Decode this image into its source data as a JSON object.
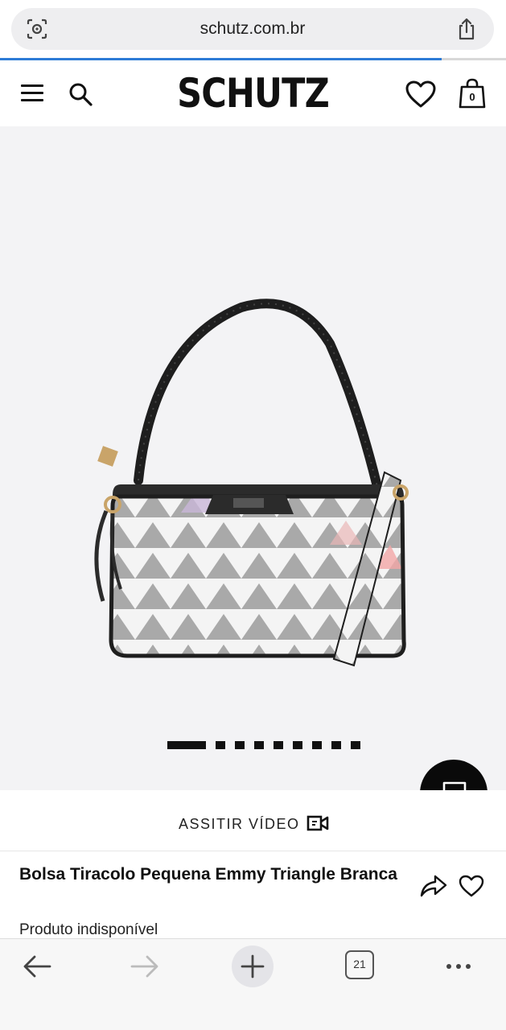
{
  "browser": {
    "url": "schutz.com.br",
    "tab_count": "21"
  },
  "header": {
    "logo": "SCHUTZ",
    "cart_count": "0"
  },
  "gallery": {
    "image_count": 9,
    "active_index": 0
  },
  "video": {
    "label": "ASSITIR VÍDEO"
  },
  "product": {
    "title": "Bolsa Tiracolo Pequena Emmy Triangle Branca",
    "availability": "Produto indisponível"
  },
  "colors": {
    "accent_loading": "#2d7bd6",
    "brand_text": "#111111",
    "gallery_bg": "#f3f3f5"
  }
}
